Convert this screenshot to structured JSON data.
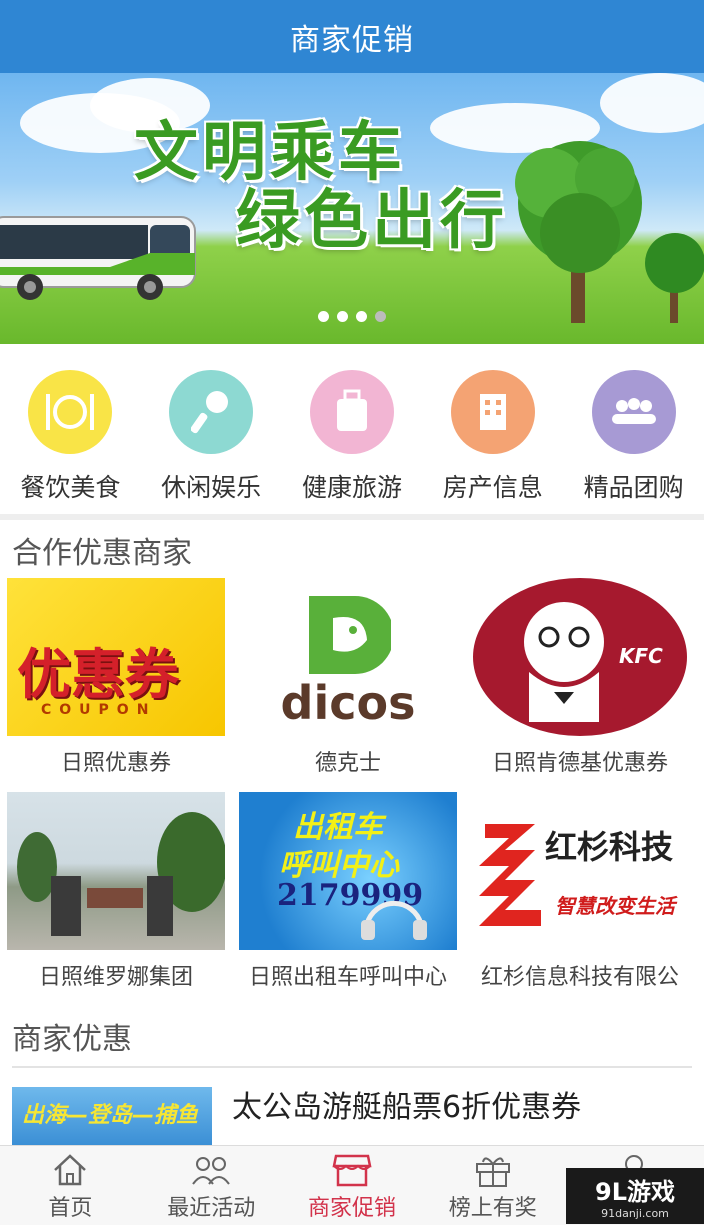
{
  "header": {
    "title": "商家促销"
  },
  "banner": {
    "slogan_line1": "文明乘车",
    "slogan_line2": "绿色出行",
    "slide_count": 4,
    "active_slide": 1
  },
  "categories": [
    {
      "label": "餐饮美食",
      "icon": "plate-cutlery-icon",
      "color": "#f9e447"
    },
    {
      "label": "休闲娱乐",
      "icon": "microphone-icon",
      "color": "#8dd9d2"
    },
    {
      "label": "健康旅游",
      "icon": "luggage-icon",
      "color": "#f2b5d3"
    },
    {
      "label": "房产信息",
      "icon": "building-icon",
      "color": "#f4a373"
    },
    {
      "label": "精品团购",
      "icon": "group-icon",
      "color": "#a79ad4"
    }
  ],
  "partners_section": {
    "title": "合作优惠商家"
  },
  "merchants": [
    {
      "name": "日照优惠券",
      "logo_text": "优惠券",
      "logo_sub": "COUPON"
    },
    {
      "name": "德克士",
      "logo_text": "dicos"
    },
    {
      "name": "日照肯德基优惠券",
      "logo_text": "KFC"
    },
    {
      "name": "日照维罗娜集团"
    },
    {
      "name": "日照出租车呼叫中心",
      "logo_text": "出租车",
      "logo_line2": "呼叫中心",
      "logo_phone": "2179999"
    },
    {
      "name": "红杉信息科技有限公",
      "logo_text": "红杉科技",
      "logo_sub": "智慧改变生活"
    }
  ],
  "deals_section": {
    "title": "商家优惠"
  },
  "deals": [
    {
      "title": "太公岛游艇船票6折优惠券",
      "image_text": "出海—登岛—捕鱼"
    }
  ],
  "tabbar": [
    {
      "label": "首页",
      "icon": "home-icon",
      "active": false
    },
    {
      "label": "最近活动",
      "icon": "people-icon",
      "active": false
    },
    {
      "label": "商家促销",
      "icon": "store-icon",
      "active": true
    },
    {
      "label": "榜上有奖",
      "icon": "gift-icon",
      "active": false
    },
    {
      "label": "",
      "icon": "location-icon",
      "active": false
    }
  ],
  "watermark": {
    "main": "9L游戏",
    "sub": "91danji.com"
  }
}
